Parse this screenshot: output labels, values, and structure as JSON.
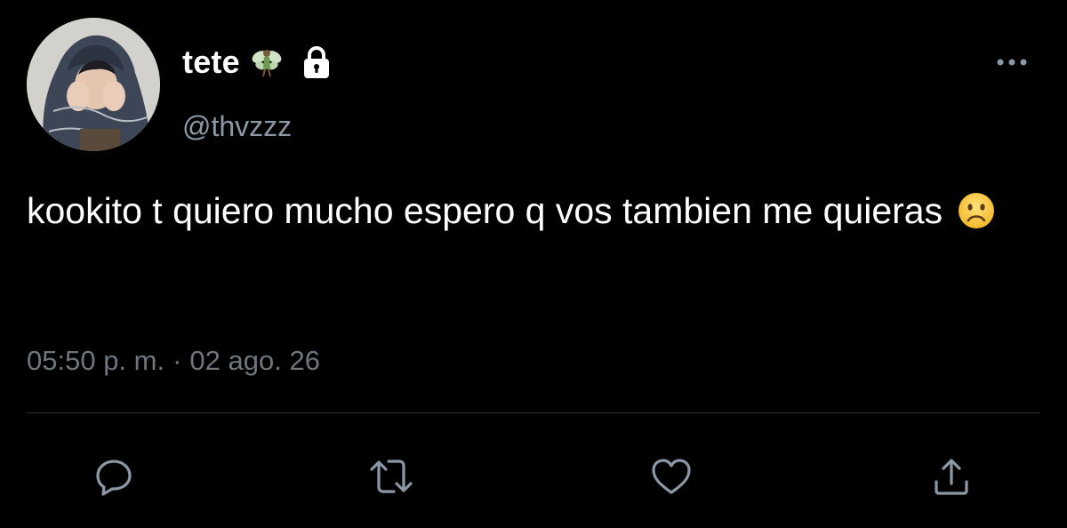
{
  "tweet": {
    "author": {
      "display_name": "tete",
      "handle": "@thvzzz",
      "badges": [
        "fairy-emoji-icon",
        "lock-icon"
      ]
    },
    "text": "kookito t quiero mucho espero q vos tambien me quieras",
    "text_emoji": "slightly-frowning-face-emoji",
    "timestamp": {
      "time": "05:50 p. m.",
      "separator": "·",
      "date": "02 ago. 26"
    },
    "more_menu_icon": "more-icon"
  },
  "actions": [
    {
      "name": "reply",
      "icon": "reply-icon"
    },
    {
      "name": "retweet",
      "icon": "retweet-icon"
    },
    {
      "name": "like",
      "icon": "heart-icon"
    },
    {
      "name": "share",
      "icon": "share-icon"
    }
  ],
  "colors": {
    "background": "#000000",
    "primary_text": "#ffffff",
    "secondary_text": "#8b98a5",
    "timestamp_text": "#6e767d",
    "icon": "#8b98a5",
    "divider": "#2f3336"
  }
}
